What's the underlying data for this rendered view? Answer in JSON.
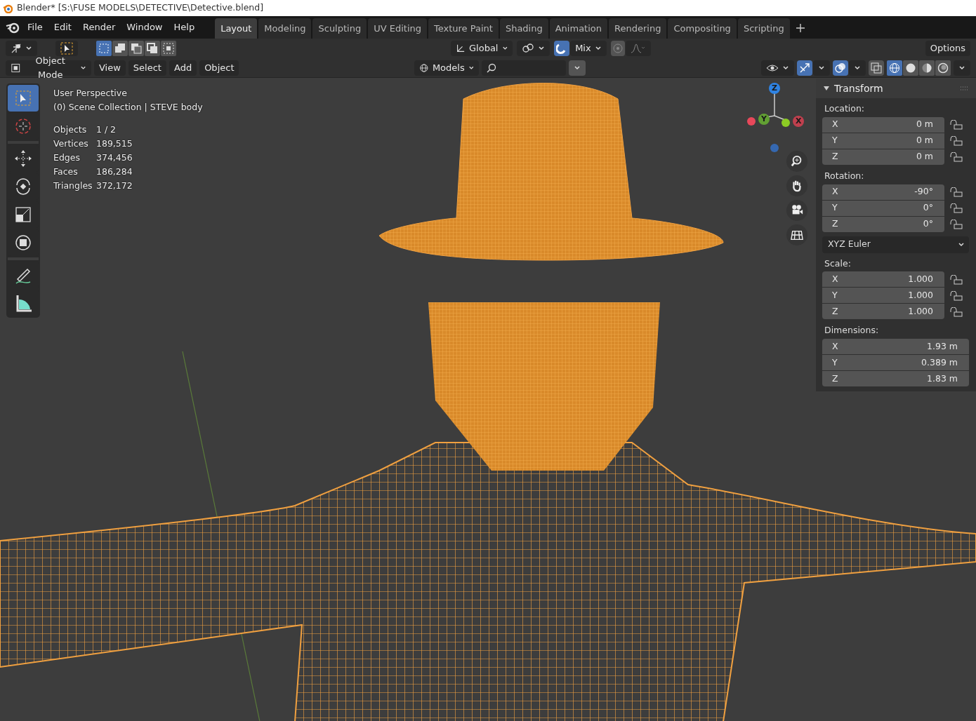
{
  "window": {
    "title": "Blender* [S:\\FUSE MODELS\\DETECTIVE\\Detective.blend]"
  },
  "menu": [
    "File",
    "Edit",
    "Render",
    "Window",
    "Help"
  ],
  "workspaces": [
    {
      "label": "Layout",
      "selected": true
    },
    {
      "label": "Modeling",
      "selected": false
    },
    {
      "label": "Sculpting",
      "selected": false
    },
    {
      "label": "UV Editing",
      "selected": false
    },
    {
      "label": "Texture Paint",
      "selected": false
    },
    {
      "label": "Shading",
      "selected": false
    },
    {
      "label": "Animation",
      "selected": false
    },
    {
      "label": "Rendering",
      "selected": false
    },
    {
      "label": "Compositing",
      "selected": false
    },
    {
      "label": "Scripting",
      "selected": false
    }
  ],
  "tool_header": {
    "orientation": "Global",
    "snap_on": true,
    "snap_target": "Mix",
    "options": "Options"
  },
  "select_modes": [
    {
      "selected": true
    },
    {
      "selected": false
    },
    {
      "selected": false
    },
    {
      "selected": false
    },
    {
      "selected": false
    }
  ],
  "viewport_header": {
    "mode": "Object Mode",
    "menus": [
      "View",
      "Select",
      "Add",
      "Object"
    ],
    "collection": "Models"
  },
  "shading": [
    {
      "kind": "wireframe",
      "selected": true
    },
    {
      "kind": "solid",
      "selected": false
    },
    {
      "kind": "material",
      "selected": false
    },
    {
      "kind": "rendered",
      "selected": false
    }
  ],
  "tools": [
    {
      "kind": "select",
      "selected": true
    },
    {
      "kind": "cursor",
      "selected": false
    },
    {
      "kind": "move",
      "selected": false
    },
    {
      "kind": "rotate",
      "selected": false
    },
    {
      "kind": "scale",
      "selected": false
    },
    {
      "kind": "transform",
      "selected": false
    },
    {
      "kind": "annotate",
      "selected": false
    },
    {
      "kind": "measure",
      "selected": false
    }
  ],
  "info": {
    "view": "User Perspective",
    "context": "(0) Scene Collection | STEVE body",
    "stats": [
      {
        "label": "Objects",
        "value": "1 / 2"
      },
      {
        "label": "Vertices",
        "value": "189,515"
      },
      {
        "label": "Edges",
        "value": "374,456"
      },
      {
        "label": "Faces",
        "value": "186,284"
      },
      {
        "label": "Triangles",
        "value": "372,172"
      }
    ]
  },
  "gizmo": {
    "axes": [
      "Z",
      "Y",
      "X"
    ]
  },
  "transform_panel": {
    "title": "Transform",
    "groups": [
      {
        "label": "Location:",
        "fields": [
          {
            "axis": "X",
            "value": "0 m",
            "locked": false
          },
          {
            "axis": "Y",
            "value": "0 m",
            "locked": false
          },
          {
            "axis": "Z",
            "value": "0 m",
            "locked": false
          }
        ]
      },
      {
        "label": "Rotation:",
        "fields": [
          {
            "axis": "X",
            "value": "-90°",
            "locked": false
          },
          {
            "axis": "Y",
            "value": "0°",
            "locked": false
          },
          {
            "axis": "Z",
            "value": "0°",
            "locked": false
          }
        ],
        "mode": "XYZ Euler"
      },
      {
        "label": "Scale:",
        "fields": [
          {
            "axis": "X",
            "value": "1.000",
            "locked": false
          },
          {
            "axis": "Y",
            "value": "1.000",
            "locked": false
          },
          {
            "axis": "Z",
            "value": "1.000",
            "locked": false
          }
        ]
      },
      {
        "label": "Dimensions:",
        "fields": [
          {
            "axis": "X",
            "value": "1.93 m"
          },
          {
            "axis": "Y",
            "value": "0.389 m"
          },
          {
            "axis": "Z",
            "value": "1.83 m"
          }
        ]
      }
    ]
  }
}
